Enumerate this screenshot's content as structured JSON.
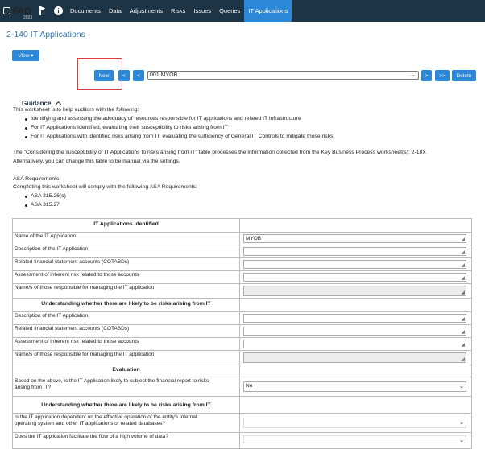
{
  "nav": {
    "brand": "FAQ",
    "brand_year": "2023",
    "items": [
      "Documents",
      "Data",
      "Adjustments",
      "Risks",
      "Issues",
      "Queries",
      "IT Applications"
    ],
    "active_index": 6
  },
  "page": {
    "title": "2-140 IT Applications"
  },
  "toolbar": {
    "view_label": "View ▾",
    "new_label": "New",
    "first_label": "<",
    "prev_label": "<",
    "selected_app": "001 MYOB",
    "next_label": ">",
    "last_label": ">>",
    "delete_label": "Delete"
  },
  "guidance": {
    "heading": "Guidance",
    "intro": "This worksheet is to help auditors with the following:",
    "bullets": [
      "Identifying and assessing the adequacy of resources responsible for IT applications and related IT infrastructure",
      "For IT Applications Identified, evaluating their susceptibility to risks arising from IT",
      "For IT Applications with identified risks arising from IT, evaluating the sufficiency of General IT Controls to mitigate those risks"
    ],
    "para1": "The \"Considering the susceptibility of IT Applications to risks arising from IT\" table processes the information collected from the Key Business Process worksheet(s): 2-18X",
    "para2": "Alternatively, you can change this table to be manual via the settings.",
    "asa_heading": "ASA Requirements",
    "asa_intro": "Completing this worksheet will comply with the following ASA Requirements:",
    "asa_items": [
      "ASA 315.26(c)",
      "ASA 315.27"
    ]
  },
  "table": {
    "section1": {
      "header": "IT Applications identified",
      "rows": [
        {
          "label": "Name of the IT Application",
          "value": "MYOB"
        },
        {
          "label": "Description of the IT Application",
          "value": ""
        },
        {
          "label": "Related financial statement accounts (COTABDs)",
          "value": ""
        },
        {
          "label": "Assessment of inherent risk related to those accounts",
          "value": ""
        },
        {
          "label": "Name/s of those responsible for managing the IT application",
          "value": ""
        }
      ]
    },
    "section2": {
      "header": "Understanding whether there are likely to be risks arising from IT",
      "rows": [
        {
          "label": "Description of the IT Application",
          "value": ""
        },
        {
          "label": "Related financial statement accounts (COTABDs)",
          "value": ""
        },
        {
          "label": "Assessment of inherent risk related to those accounts",
          "value": ""
        },
        {
          "label": "Name/s of those responsible for managing the IT application",
          "value": ""
        }
      ]
    },
    "section3": {
      "header": "Evaluation",
      "question_line1": "Based on the above, is the IT Application likely to subject the financial report to risks",
      "question_line2": "arising from IT?",
      "answer": "No"
    },
    "section4": {
      "header": "Understanding whether there are likely to be risks arising from IT",
      "q1_line1": "Is the IT application dependent on the effective operation of the entity's internal",
      "q1_line2": "operating system and other IT applications or related databases?",
      "q2": "Does the IT application facilitate the flow of a high volume of data?"
    }
  },
  "colors": {
    "nav_bg": "#1d3447",
    "accent": "#2b88d8",
    "title": "#2e75b6",
    "highlight": "#e23b3b"
  }
}
